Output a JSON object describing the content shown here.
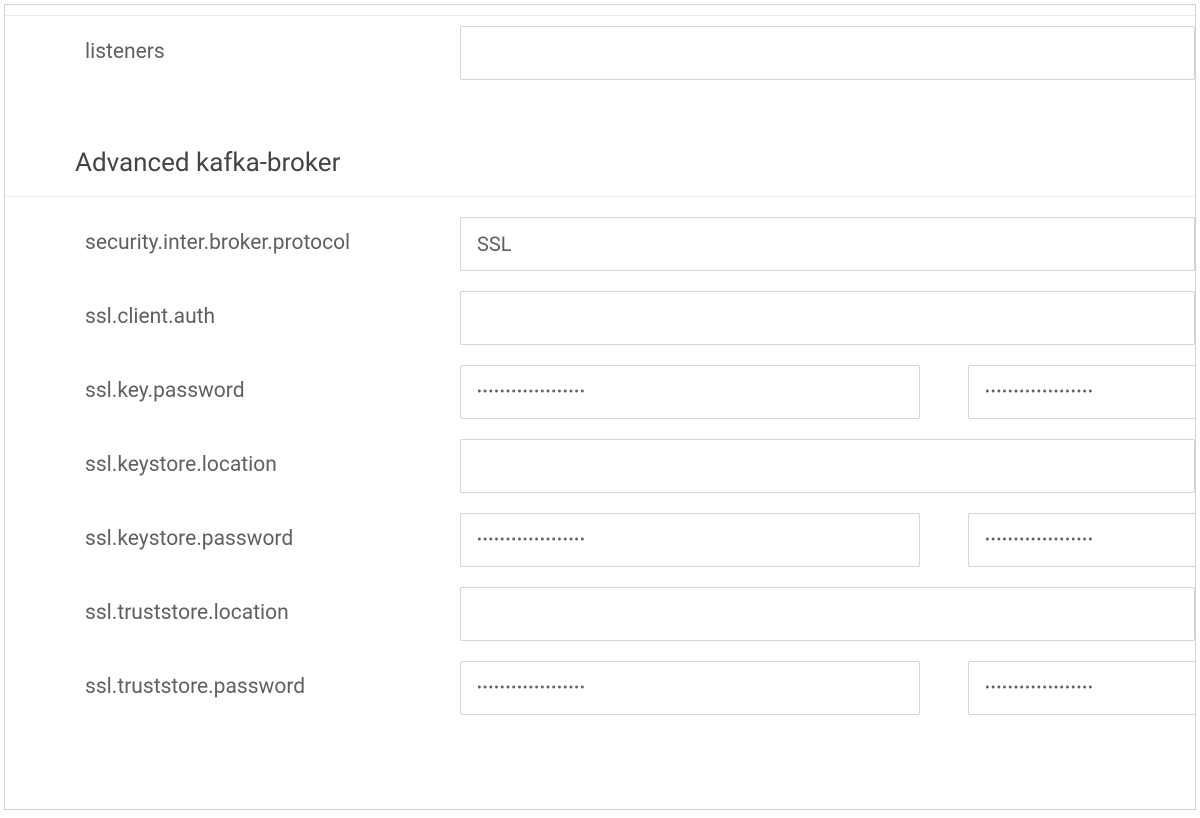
{
  "top_section": {
    "fields": {
      "listeners": {
        "label": "listeners",
        "value": ""
      }
    }
  },
  "advanced_section": {
    "title": "Advanced kafka-broker",
    "fields": {
      "security_inter_broker_protocol": {
        "label": "security.inter.broker.protocol",
        "value": "SSL"
      },
      "ssl_client_auth": {
        "label": "ssl.client.auth",
        "value": ""
      },
      "ssl_key_password": {
        "label": "ssl.key.password",
        "value1": "•••••••••••••••••••",
        "value2": "•••••••••••••••••••"
      },
      "ssl_keystore_location": {
        "label": "ssl.keystore.location",
        "value": ""
      },
      "ssl_keystore_password": {
        "label": "ssl.keystore.password",
        "value1": "•••••••••••••••••••",
        "value2": "•••••••••••••••••••"
      },
      "ssl_truststore_location": {
        "label": "ssl.truststore.location",
        "value": ""
      },
      "ssl_truststore_password": {
        "label": "ssl.truststore.password",
        "value1": "•••••••••••••••••••",
        "value2": "•••••••••••••••••••"
      }
    }
  }
}
